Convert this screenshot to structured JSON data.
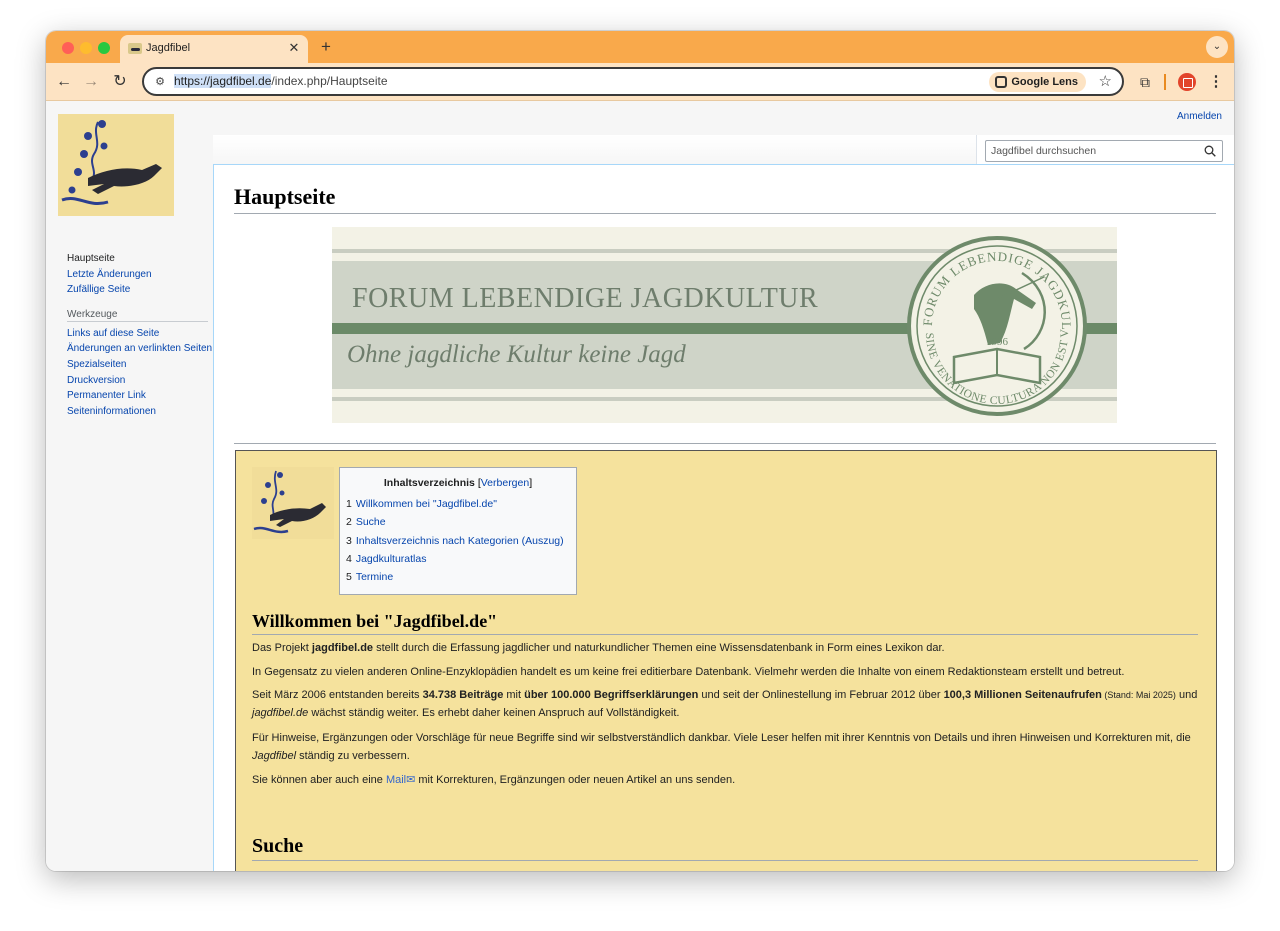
{
  "browser": {
    "tab_title": "Jagdfibel",
    "url_host": "https://jagdfibel.de",
    "url_path": "/index.php/Hauptseite",
    "lens_label": "Google Lens",
    "accent": "#f9a94b"
  },
  "header": {
    "login": "Anmelden",
    "search_placeholder": "Jagdfibel durchsuchen"
  },
  "sidebar": {
    "nav": [
      "Hauptseite",
      "Letzte Änderungen",
      "Zufällige Seite"
    ],
    "tools_heading": "Werkzeuge",
    "tools": [
      "Links auf diese Seite",
      "Änderungen an verlinkten Seiten",
      "Spezialseiten",
      "Druckversion",
      "Permanenter Link",
      "Seiteninformationen"
    ]
  },
  "main": {
    "title": "Hauptseite",
    "banner": {
      "line1": "FORUM LEBENDIGE JAGDKULTUR",
      "line2": "Ohne jagdliche Kultur keine Jagd",
      "seal_top": "FORUM LEBENDIGE JAGDKULTUR",
      "seal_bottom": "SINE VENATIONE CULTURA NON EST VENATIO",
      "seal_year": "1996"
    },
    "toc": {
      "title": "Inhaltsverzeichnis",
      "toggle": "Verbergen",
      "items": [
        {
          "num": "1",
          "label": "Willkommen bei \"Jagdfibel.de\""
        },
        {
          "num": "2",
          "label": "Suche"
        },
        {
          "num": "3",
          "label": "Inhaltsverzeichnis nach Kategorien (Auszug)"
        },
        {
          "num": "4",
          "label": "Jagdkulturatlas"
        },
        {
          "num": "5",
          "label": "Termine"
        }
      ]
    },
    "welcome": {
      "heading": "Willkommen bei \"Jagdfibel.de\"",
      "p1": [
        "Das Projekt ",
        "jagdfibel.de",
        " stellt durch die Erfassung jagdlicher und naturkundlicher Themen eine Wissensdatenbank in Form eines Lexikon dar."
      ],
      "p2": "In Gegensatz zu vielen anderen Online-Enzyklopädien handelt es um keine frei editierbare Datenbank. Vielmehr werden die Inhalte von einem Redaktionsteam erstellt und betreut.",
      "p3": [
        "Seit März 2006 entstanden bereits ",
        "34.738 Beiträge",
        " mit ",
        "über 100.000 Begriffserklärungen",
        " und seit der Onlinestellung im Februar 2012 über ",
        "100,3 Millionen Seitenaufrufen",
        " (Stand: Mai 2025)",
        " und ",
        "jagdfibel.de",
        " wächst ständig weiter. Es erhebt daher keinen Anspruch auf Vollständigkeit."
      ],
      "p4": [
        "Für Hinweise, Ergänzungen oder Vorschläge für neue Begriffe sind wir selbstverständlich dankbar. Viele Leser helfen mit ihrer Kenntnis von Details und ihren Hinweisen und Korrekturen mit, die ",
        "Jagdfibel",
        " ständig zu verbessern."
      ],
      "p5": [
        "Sie können aber auch eine ",
        "Mail",
        " mit Korrekturen, Ergänzungen oder neuen Artikel an uns senden."
      ]
    },
    "suche_heading": "Suche"
  }
}
